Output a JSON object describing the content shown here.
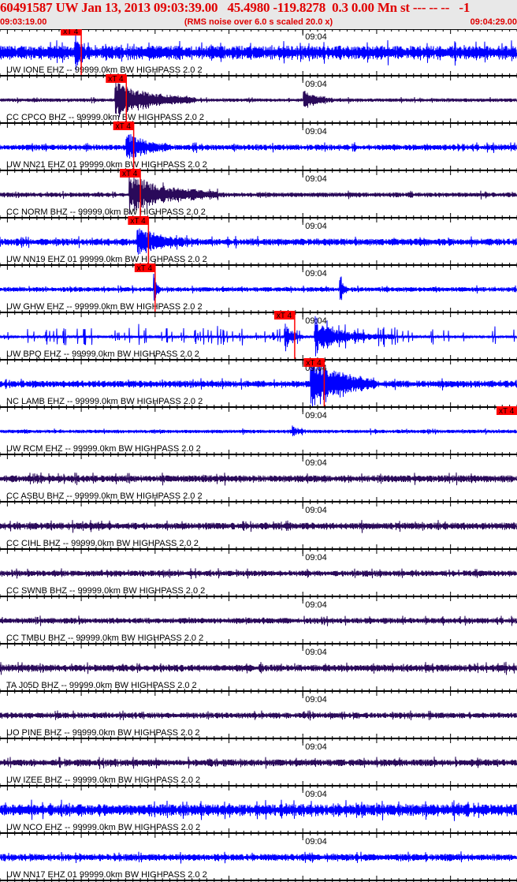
{
  "header": {
    "title": "60491587 UW Jan 13, 2013 09:03:39.00   45.4980 -119.8278  0.3 0.00 Mn st --- -- --   -1",
    "start_time": "09:03:19.00",
    "end_time": "09:04:29.00",
    "rms_note": "(RMS noise over 6.0 s scaled 20.0 x)"
  },
  "time_axis": {
    "start": "09:03:19.00",
    "end": "09:04:29.00",
    "minute_label": "09:04"
  },
  "colors": {
    "text_red": "#e00000",
    "pick": "#ff0000",
    "blue": "#0000ff",
    "purple": "#2a0a5a",
    "header_bg": "#e8e8e8"
  },
  "pick_label": "xT 4",
  "traces": [
    {
      "label": "UW IONE EHZ -- 99999.0km BW  HIGHPASS  2.0  2",
      "color": "blue",
      "pick": "09:03:30.0",
      "noise": 6,
      "bursts": [
        [
          "09:03:29.1",
          1.5,
          12
        ]
      ]
    },
    {
      "label": "CC CPCO BHZ -- 99999.0km BW  HIGHPASS  2.0  2",
      "color": "purple",
      "pick": "09:03:36.1",
      "noise": 1.5,
      "bursts": [
        [
          "09:03:34.5",
          11,
          17
        ],
        [
          "09:04:00.0",
          4,
          10
        ]
      ]
    },
    {
      "label": "UW NN21 EHZ 01 99999.0km BW  HIGHPASS  2.0  2",
      "color": "blue",
      "pick": "09:03:37.1",
      "noise": 2.5,
      "bursts": [
        [
          "09:03:36.0",
          6,
          14
        ]
      ]
    },
    {
      "label": "CC NORM BHZ -- 99999.0km BW  HIGHPASS  2.0  2",
      "color": "purple",
      "pick": "09:03:38.0",
      "noise": 2,
      "bursts": [
        [
          "09:03:36.5",
          12,
          19
        ]
      ]
    },
    {
      "label": "UW NN19 EHZ 01 99999.0km BW  HIGHPASS  2.0  2",
      "color": "blue",
      "pick": "09:03:39.1",
      "noise": 3,
      "bursts": [
        [
          "09:03:37.5",
          7,
          12
        ]
      ]
    },
    {
      "label": "UW GHW EHZ -- 99999.0km BW  HIGHPASS  2.0  2",
      "color": "blue",
      "pick": "09:03:40.0",
      "noise": 2,
      "bursts": [
        [
          "09:03:39.8",
          0.8,
          15
        ],
        [
          "09:04:04.9",
          0.8,
          22
        ]
      ]
    },
    {
      "label": "UW BPQ EHZ -- 99999.0km BW  HIGHPASS  2.0  2",
      "color": "blue",
      "pick": "09:03:58.9",
      "noise": 1,
      "spiky": true,
      "bursts": [
        [
          "09:03:57.5",
          2.5,
          13
        ],
        [
          "09:04:01.5",
          11,
          13
        ]
      ]
    },
    {
      "label": "NC LAMB EHZ -- 99999.0km BW  HIGHPASS  2.0  2",
      "color": "blue",
      "pick": "09:04:02.9",
      "noise": 3,
      "bursts": [
        [
          "09:04:01.0",
          9,
          25
        ]
      ]
    },
    {
      "label": "UW RCM EHZ -- 99999.0km BW  HIGHPASS  2.0  2",
      "color": "blue",
      "pick": "09:04:29.0",
      "noise": 1.5,
      "bursts": [
        [
          "09:03:58.5",
          2,
          5
        ]
      ]
    },
    {
      "label": "CC ASBU BHZ -- 99999.0km BW  HIGHPASS  2.0  2",
      "color": "purple",
      "noise": 3,
      "bursts": []
    },
    {
      "label": "CC CIHL BHZ -- 99999.0km BW  HIGHPASS  2.0  2",
      "color": "purple",
      "noise": 3,
      "bursts": []
    },
    {
      "label": "CC SWNB BHZ -- 99999.0km BW  HIGHPASS  2.0  2",
      "color": "purple",
      "noise": 2.5,
      "bursts": []
    },
    {
      "label": "CC TMBU BHZ -- 99999.0km BW  HIGHPASS  2.0  2",
      "color": "purple",
      "noise": 2.5,
      "bursts": []
    },
    {
      "label": "TA J05D BHZ -- 99999.0km BW  HIGHPASS  2.0  2",
      "color": "purple",
      "noise": 3,
      "bursts": []
    },
    {
      "label": "UO PINE BHZ -- 99999.0km BW  HIGHPASS  2.0  2",
      "color": "purple",
      "noise": 2.5,
      "bursts": []
    },
    {
      "label": "UW IZEE BHZ -- 99999.0km BW  HIGHPASS  2.0  2",
      "color": "purple",
      "noise": 3,
      "bursts": []
    },
    {
      "label": "UW NCO EHZ -- 99999.0km BW  HIGHPASS  2.0  2",
      "color": "blue",
      "noise": 5,
      "bursts": []
    },
    {
      "label": "UW NN17 EHZ 01 99999.0km BW  HIGHPASS  2.0  2",
      "color": "blue",
      "noise": 3,
      "bursts": []
    }
  ]
}
